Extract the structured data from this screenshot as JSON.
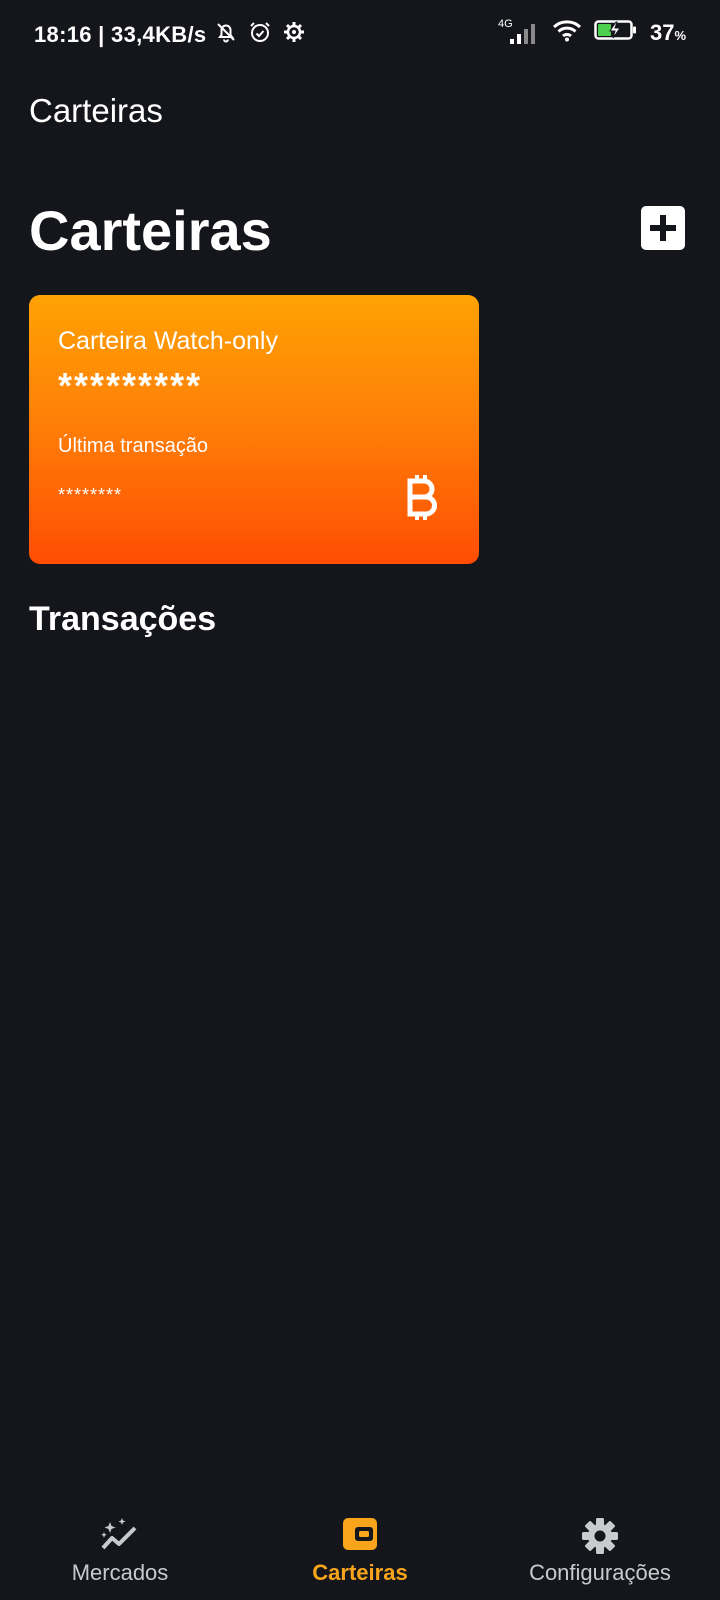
{
  "status_bar": {
    "time_speed": "18:16 | 33,4KB/s",
    "network": "4G",
    "battery_percent": "37",
    "battery_unit": "%"
  },
  "app_bar": {
    "title": "Carteiras"
  },
  "wallets_section": {
    "title": "Carteiras",
    "add_icon": "plus-icon"
  },
  "wallet_card": {
    "name": "Carteira Watch-only",
    "balance": "*********",
    "last_tx_label": "Última transação",
    "last_tx_value": "********",
    "coin_icon": "bitcoin-icon",
    "gradient_top": "#ffa203",
    "gradient_bottom": "#ff4d02"
  },
  "transactions_section": {
    "title": "Transações"
  },
  "bottom_nav": {
    "active_color": "#f8a51c",
    "items": [
      {
        "label": "Mercados",
        "icon": "sparkle-chart-icon"
      },
      {
        "label": "Carteiras",
        "icon": "wallet-icon"
      },
      {
        "label": "Configurações",
        "icon": "gear-icon"
      }
    ]
  }
}
